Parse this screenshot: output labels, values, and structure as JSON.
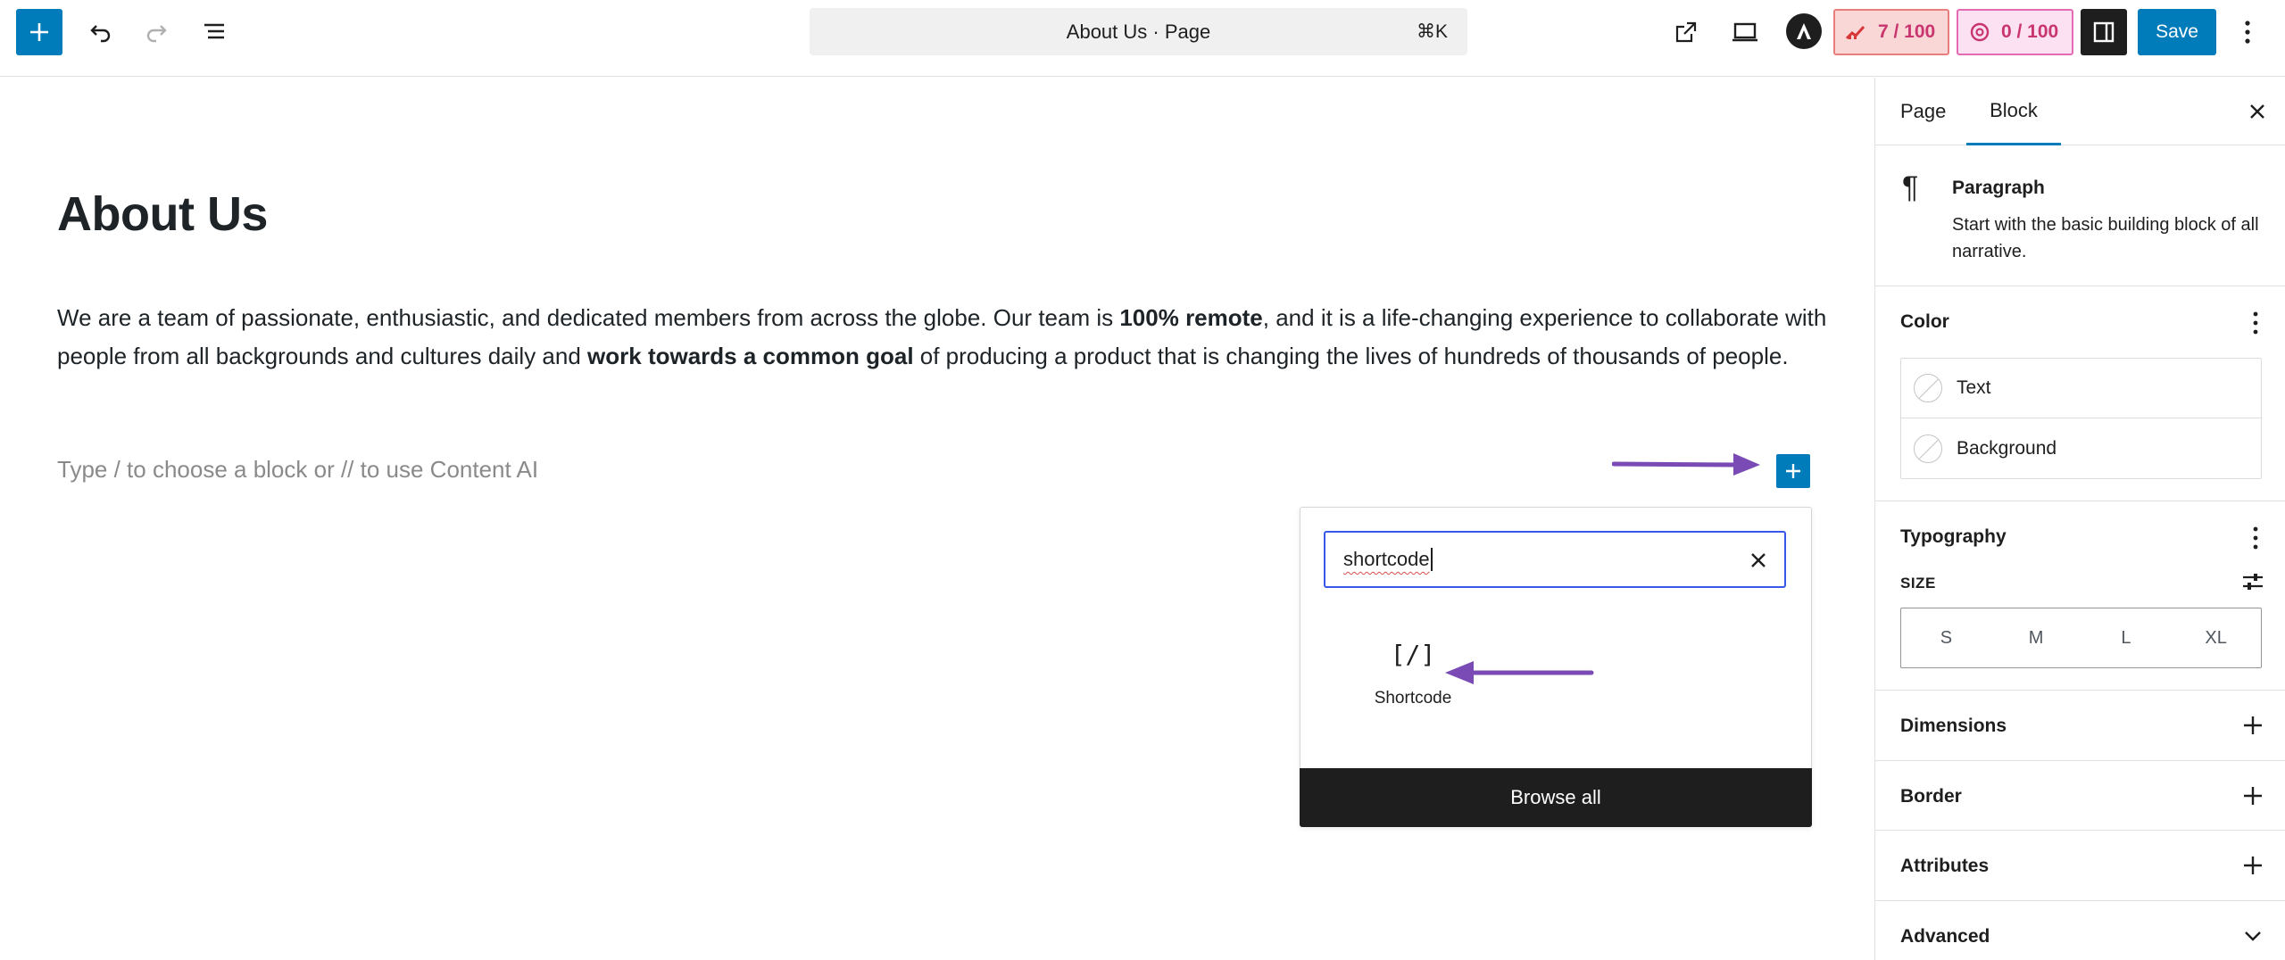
{
  "toolbar": {
    "document_title": "About Us · Page",
    "shortcut": "⌘K",
    "seo_score": "7 / 100",
    "ai_score": "0 / 100",
    "save_label": "Save",
    "colors": {
      "primary": "#007cba",
      "dark": "#1e1e1e"
    }
  },
  "editor": {
    "page_title": "About Us",
    "paragraph": {
      "part1": "We are a team of passionate, enthusiastic, and dedicated members from across the globe. Our team is ",
      "bold1": "100% remote",
      "part2": ", and it is a life-changing experience to collaborate with people from all backgrounds and cultures daily and ",
      "bold2": "work towards a common goal",
      "part3": " of producing a product that is changing the lives of hundreds of thousands of people."
    },
    "placeholder": "Type / to choose a block or // to use Content AI"
  },
  "inserter": {
    "search_value": "shortcode",
    "result_icon": "[/]",
    "result_label": "Shortcode",
    "browse_all": "Browse all"
  },
  "annotations": {
    "arrow_color": "#7b4bb5"
  },
  "sidebar": {
    "tabs": [
      "Page",
      "Block"
    ],
    "active_tab": "Block",
    "block_card": {
      "icon": "¶",
      "title": "Paragraph",
      "description": "Start with the basic building block of all narrative."
    },
    "color": {
      "title": "Color",
      "items": [
        "Text",
        "Background"
      ]
    },
    "typography": {
      "title": "Typography",
      "size_label": "SIZE",
      "sizes": [
        "S",
        "M",
        "L",
        "XL"
      ]
    },
    "panels": [
      "Dimensions",
      "Border",
      "Attributes",
      "Advanced"
    ]
  }
}
